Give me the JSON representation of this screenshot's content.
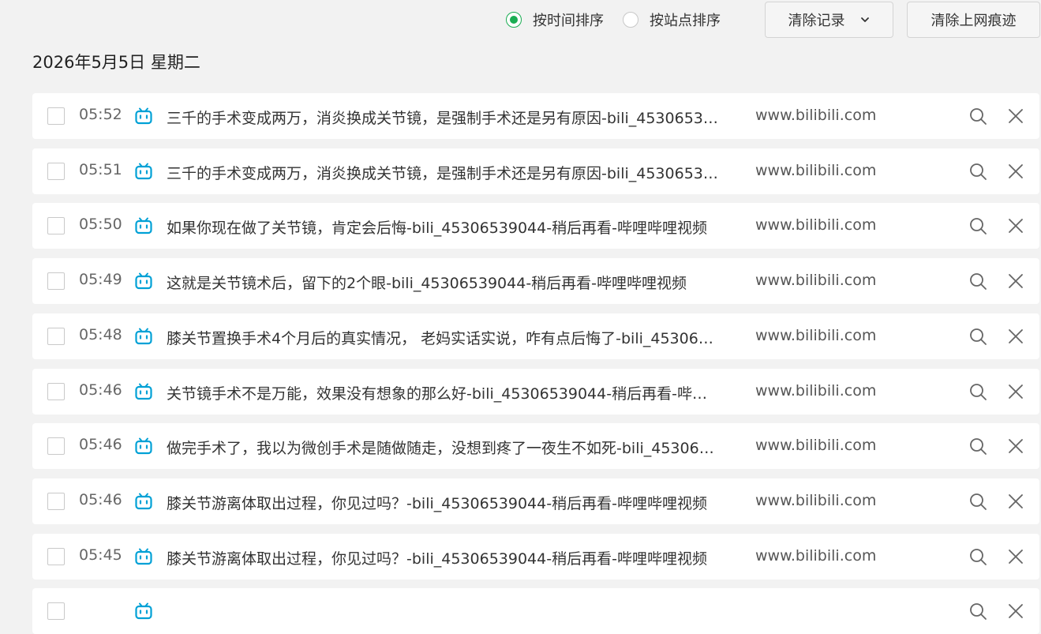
{
  "sort": {
    "by_time_label": "按时间排序",
    "by_site_label": "按站点排序",
    "selected": "by_time"
  },
  "buttons": {
    "clear_records_label": "清除记录",
    "clear_traces_label": "清除上网痕迹"
  },
  "date_heading": "2026年5月5日 星期二",
  "colors": {
    "accent_green": "#1aad53",
    "bilibili_blue": "#00a1d6",
    "background": "#f2f2f2"
  },
  "history": [
    {
      "time": "05:52",
      "icon": "bilibili-icon",
      "title": "三千的手术变成两万，消炎换成关节镜，是强制手术还是另有原因-bili_4530653…",
      "site": "www.bilibili.com"
    },
    {
      "time": "05:51",
      "icon": "bilibili-icon",
      "title": "三千的手术变成两万，消炎换成关节镜，是强制手术还是另有原因-bili_4530653…",
      "site": "www.bilibili.com"
    },
    {
      "time": "05:50",
      "icon": "bilibili-icon",
      "title": "如果你现在做了关节镜，肯定会后悔-bili_45306539044-稍后再看-哔哩哔哩视频",
      "site": "www.bilibili.com"
    },
    {
      "time": "05:49",
      "icon": "bilibili-icon",
      "title": "这就是关节镜术后，留下的2个眼-bili_45306539044-稍后再看-哔哩哔哩视频",
      "site": "www.bilibili.com"
    },
    {
      "time": "05:48",
      "icon": "bilibili-icon",
      "title": "膝关节置换手术4个月后的真实情况， 老妈实话实说，咋有点后悔了-bili_45306…",
      "site": "www.bilibili.com"
    },
    {
      "time": "05:46",
      "icon": "bilibili-icon",
      "title": "关节镜手术不是万能，效果没有想象的那么好-bili_45306539044-稍后再看-哔…",
      "site": "www.bilibili.com"
    },
    {
      "time": "05:46",
      "icon": "bilibili-icon",
      "title": "做完手术了，我以为微创手术是随做随走，没想到疼了一夜生不如死-bili_45306…",
      "site": "www.bilibili.com"
    },
    {
      "time": "05:46",
      "icon": "bilibili-icon",
      "title": "膝关节游离体取出过程，你见过吗？-bili_45306539044-稍后再看-哔哩哔哩视频",
      "site": "www.bilibili.com"
    },
    {
      "time": "05:45",
      "icon": "bilibili-icon",
      "title": "膝关节游离体取出过程，你见过吗？-bili_45306539044-稍后再看-哔哩哔哩视频",
      "site": "www.bilibili.com"
    },
    {
      "time": "",
      "icon": "bilibili-icon",
      "title": "",
      "site": ""
    }
  ]
}
